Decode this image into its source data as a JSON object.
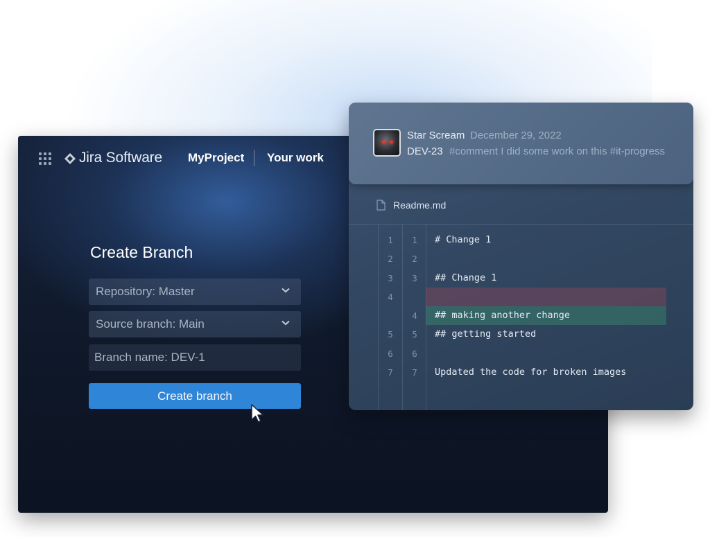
{
  "jira": {
    "brand": "Jira Software",
    "nav": {
      "project": "MyProject",
      "your_work": "Your work"
    },
    "form": {
      "title": "Create Branch",
      "repository": "Repository: Master",
      "source_branch": "Source branch: Main",
      "branch_name_placeholder": "Branch name: DEV-1",
      "create_button": "Create branch"
    },
    "icons": {
      "apps": "grid-icon",
      "logo": "jira-diamond-icon",
      "chevron": "chevron-down-icon",
      "cursor": "mouse-pointer-icon"
    },
    "colors": {
      "accent": "#2f86d9"
    }
  },
  "commit": {
    "author": "Star Scream",
    "date": "December 29, 2022",
    "issue": "DEV-23",
    "comment": "#comment I did some work on this #it-progress",
    "file": "Readme.md"
  },
  "diff": {
    "rows": [
      {
        "old": "1",
        "new": "1",
        "code": "# Change 1",
        "type": "context"
      },
      {
        "old": "2",
        "new": "2",
        "code": "",
        "type": "context"
      },
      {
        "old": "3",
        "new": "3",
        "code": "## Change 1",
        "type": "context"
      },
      {
        "old": "4",
        "new": "",
        "code": "",
        "type": "removed"
      },
      {
        "old": "",
        "new": "4",
        "code": "## making another change",
        "type": "added"
      },
      {
        "old": "5",
        "new": "5",
        "code": "## getting started",
        "type": "context"
      },
      {
        "old": "6",
        "new": "6",
        "code": "",
        "type": "context"
      },
      {
        "old": "7",
        "new": "7",
        "code": "Updated the code for broken images",
        "type": "context"
      }
    ],
    "colors": {
      "removed": "#965a5a",
      "added": "#3c8c6e"
    }
  }
}
